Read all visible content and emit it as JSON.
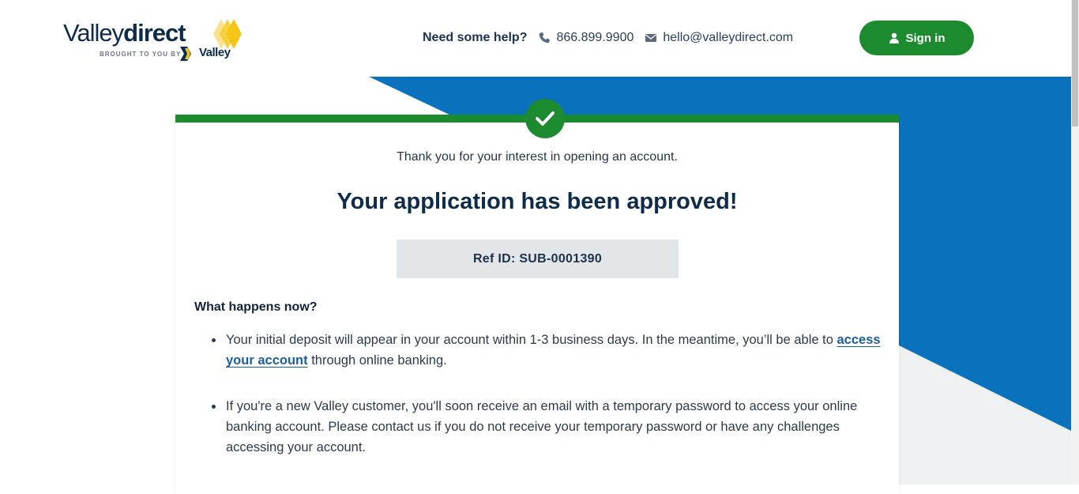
{
  "brand": {
    "logo_light": "Valley",
    "logo_bold": "direct",
    "tagline": "BROUGHT TO YOU BY",
    "parent_name": "Valley",
    "accent_yellow": "#f5c518",
    "navy": "#0e2b4a"
  },
  "header": {
    "help_label": "Need some help?",
    "phone_icon": "phone-icon",
    "phone": "866.899.9900",
    "email_icon": "envelope-icon",
    "email": "hello@valleydirect.com",
    "signin_icon": "user-icon",
    "signin_label": "Sign in"
  },
  "colors": {
    "primary_green": "#1c8a2e",
    "background_blue": "#0a72bc",
    "ref_box_bg": "#e3e6e9",
    "link_blue": "#1c5f9a"
  },
  "confirmation": {
    "status_icon": "checkmark-icon",
    "thanks_text": "Thank you for your interest in opening an account.",
    "headline": "Your application has been approved!",
    "ref_id": "Ref ID: SUB-0001390",
    "section_heading": "What happens now?",
    "bullets": [
      {
        "text_before": "Your initial deposit will appear in your account within 1-3 business days. In the meantime, you’ll be able to ",
        "link_text": "access your account",
        "text_after": " through online banking."
      },
      {
        "text": "If you're a new Valley customer, you'll soon receive an email with a temporary password to access your online banking account. Please contact us if you do not receive your temporary password or have any challenges accessing your account."
      }
    ]
  }
}
